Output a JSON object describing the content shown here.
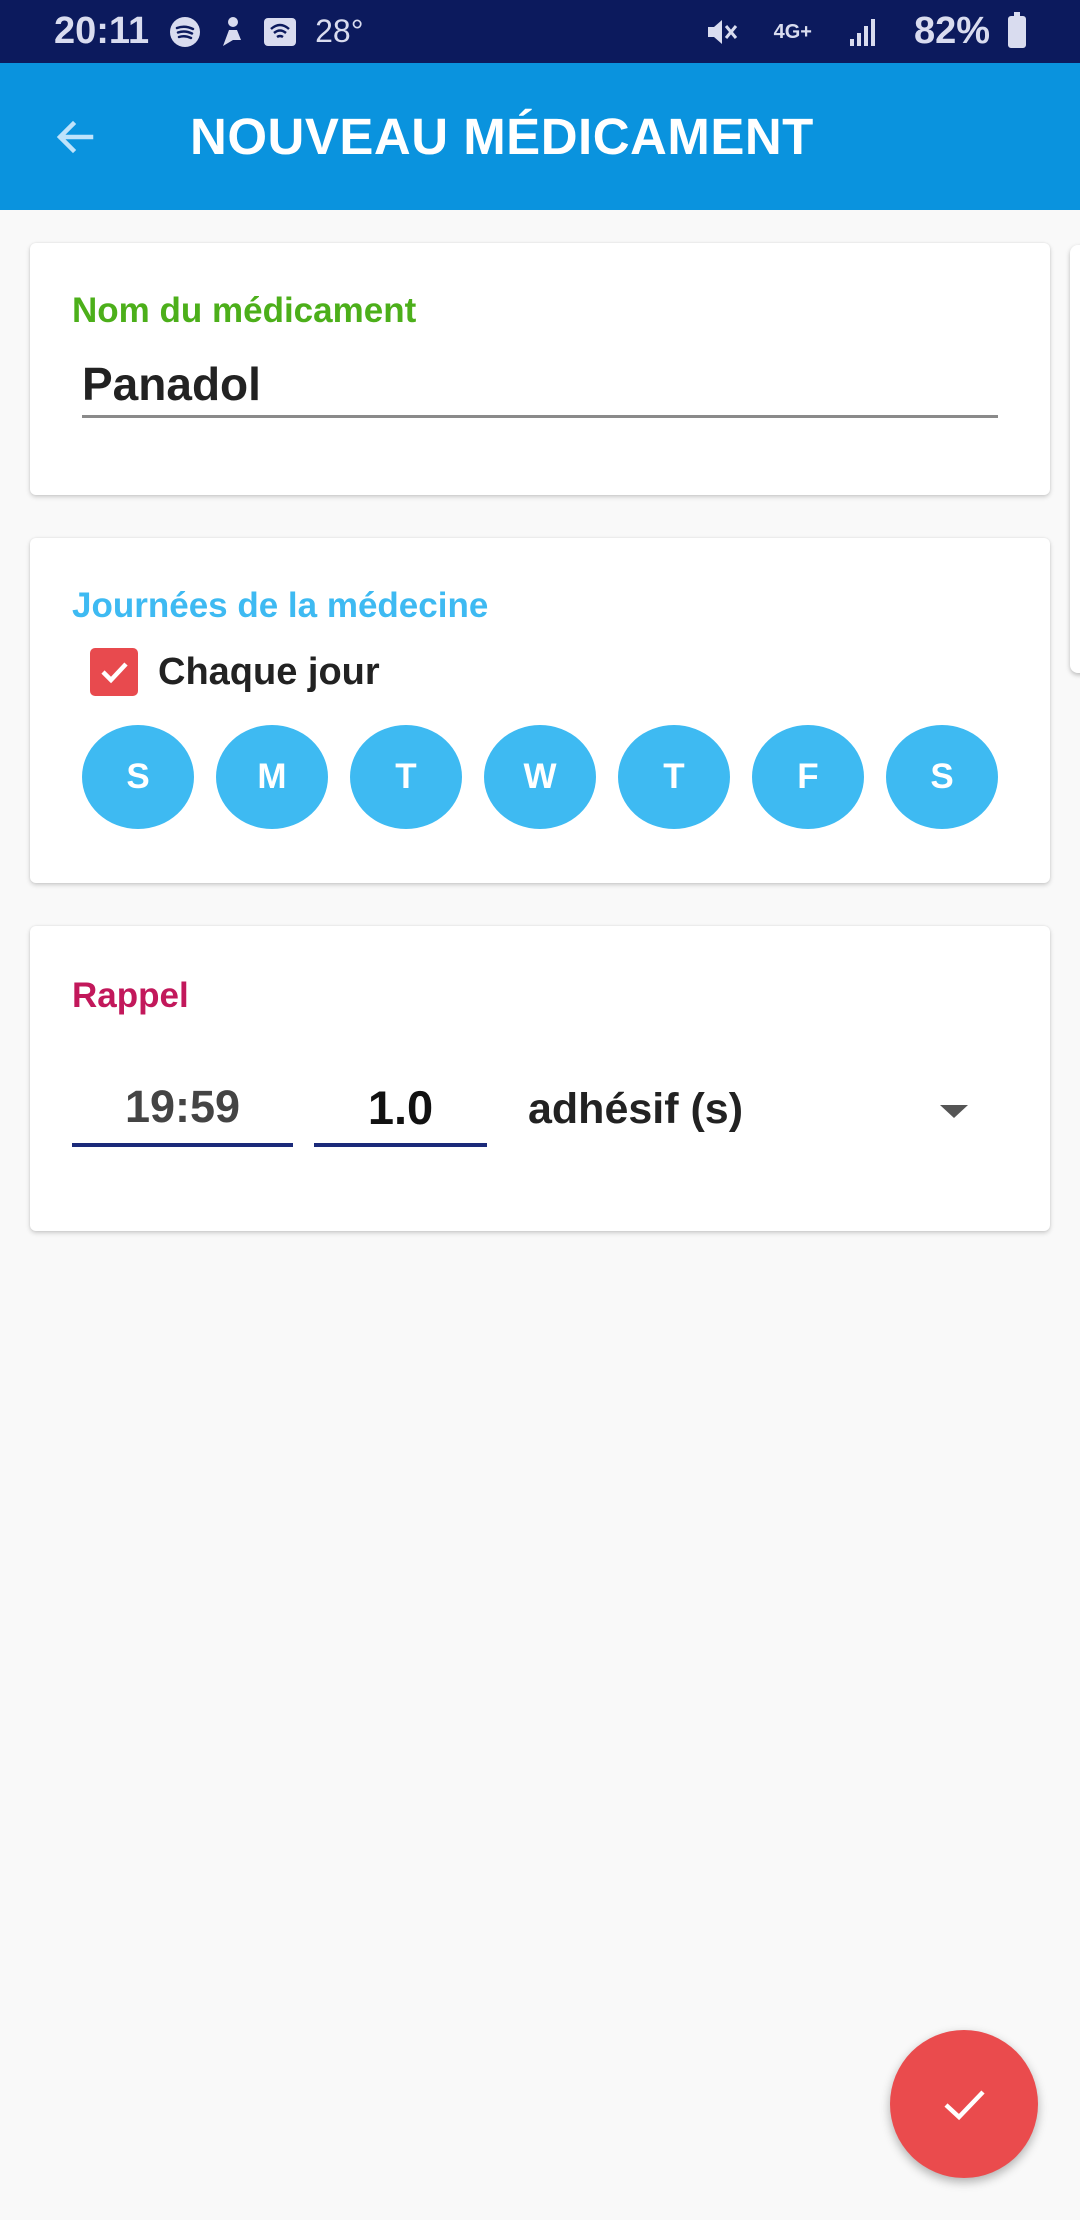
{
  "status_bar": {
    "time": "20:11",
    "temperature": "28°",
    "network": "4G+",
    "battery": "82%"
  },
  "app_bar": {
    "title": "NOUVEAU MÉDICAMENT"
  },
  "medicine_card": {
    "label": "Nom du médicament",
    "label_color": "#4caf1a",
    "value": "Panadol"
  },
  "days_card": {
    "label": "Journées de la médecine",
    "label_color": "#3ebaf2",
    "every_day_label": "Chaque jour",
    "every_day_checked": true,
    "days": [
      "S",
      "M",
      "T",
      "W",
      "T",
      "F",
      "S"
    ]
  },
  "reminder_card": {
    "label": "Rappel",
    "label_color": "#c2185b",
    "time": "19:59",
    "quantity": "1.0",
    "unit": "adhésif (s)"
  },
  "colors": {
    "app_bar": "#0a93de",
    "status_bar": "#0c1a5d",
    "fab": "#ea4b4d",
    "day_chip": "#3ebaf2"
  },
  "icons": {
    "back": "arrow-left-icon",
    "fab": "checkmark-icon",
    "checkbox": "checkmark-icon"
  }
}
